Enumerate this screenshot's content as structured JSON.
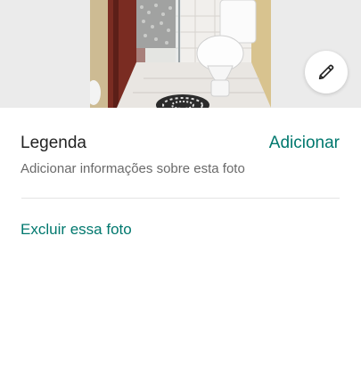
{
  "photo": {
    "icon": "bathroom-photo"
  },
  "edit_button": {
    "icon": "pencil-icon"
  },
  "caption": {
    "title": "Legenda",
    "add_label": "Adicionar",
    "hint": "Adicionar informações sobre esta foto"
  },
  "delete_label": "Excluir essa foto",
  "colors": {
    "accent": "#00786e",
    "text": "#222222",
    "muted": "#6a6a6a"
  }
}
